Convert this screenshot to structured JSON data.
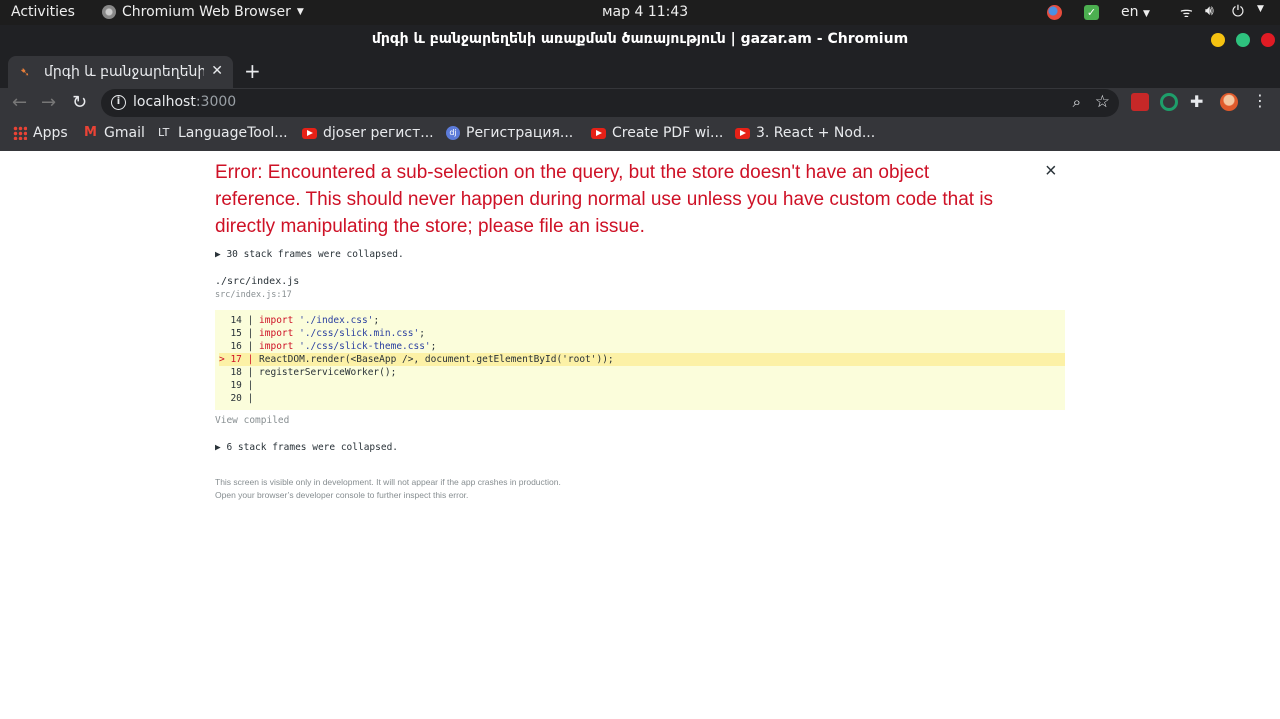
{
  "system_bar": {
    "activities": "Activities",
    "app_name": "Chromium Web Browser",
    "clock": "мар 4  11:43",
    "lang": "en"
  },
  "window": {
    "title": "մրգի և բանջարեղենի առաքման ծառայություն | gazar.am - Chromium"
  },
  "tab": {
    "title": "մրգի և բանջարեղենի առաքման ծառայություն"
  },
  "omnibox": {
    "host": "localhost",
    "port": ":3000"
  },
  "bookmarks": [
    {
      "label": "Apps"
    },
    {
      "label": "Gmail"
    },
    {
      "label": "LanguageTool..."
    },
    {
      "label": "djoser регист..."
    },
    {
      "label": "Регистрация..."
    },
    {
      "label": "Create PDF wi..."
    },
    {
      "label": "3. React + Nod..."
    }
  ],
  "error": {
    "title": "Error: Encountered a sub-selection on the query, but the store doesn't have an object reference. This should never happen during normal use unless you have custom code that is directly manipulating the store; please file an issue.",
    "close": "×",
    "collapsed_top": "▶ 30 stack frames were collapsed.",
    "file": "./src/index.js",
    "file_loc": "src/index.js:17",
    "view_compiled": "View compiled",
    "collapsed_bottom": "▶ 6 stack frames were collapsed.",
    "footnote_1": "This screen is visible only in development. It will not appear if the app crashes in production.",
    "footnote_2": "Open your browser’s developer console to further inspect this error."
  },
  "code": [
    {
      "prefix": "  14 | ",
      "kw": "import",
      "str": " './index.css'",
      "rest": ";"
    },
    {
      "prefix": "  15 | ",
      "kw": "import",
      "str": " './css/slick.min.css'",
      "rest": ";"
    },
    {
      "prefix": "  16 | ",
      "kw": "import",
      "str": " './css/slick-theme.css'",
      "rest": ";"
    },
    {
      "prefix": "> 17 | ",
      "kw": "",
      "str": "",
      "rest": "ReactDOM.render(<BaseApp />, document.getElementById('root'));"
    },
    {
      "prefix": "  18 | ",
      "kw": "",
      "str": "",
      "rest": "registerServiceWorker();"
    },
    {
      "prefix": "  19 | ",
      "kw": "",
      "str": "",
      "rest": ""
    },
    {
      "prefix": "  20 | ",
      "kw": "",
      "str": "",
      "rest": ""
    }
  ],
  "colors": {
    "error_red": "#ce1126",
    "code_bg": "#fbfddb",
    "code_highlight": "#fcf1a6"
  }
}
